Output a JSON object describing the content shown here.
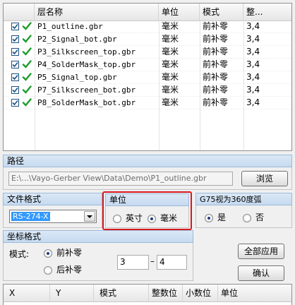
{
  "layer_table": {
    "columns": [
      "层名称",
      "单位",
      "模式",
      "整..."
    ],
    "rows": [
      {
        "name": "P1_outline.gbr",
        "unit": "毫米",
        "mode": "前补零",
        "int": "3,4",
        "checked": true
      },
      {
        "name": "P2_Signal_bot.gbr",
        "unit": "毫米",
        "mode": "前补零",
        "int": "3,4",
        "checked": true
      },
      {
        "name": "P3_Silkscreen_top.gbr",
        "unit": "毫米",
        "mode": "前补零",
        "int": "3,4",
        "checked": true
      },
      {
        "name": "P4_SolderMask_top.gbr",
        "unit": "毫米",
        "mode": "前补零",
        "int": "3,4",
        "checked": true
      },
      {
        "name": "P5_Signal_top.gbr",
        "unit": "毫米",
        "mode": "前补零",
        "int": "3,4",
        "checked": true
      },
      {
        "name": "P7_Silkscreen_bot.gbr",
        "unit": "毫米",
        "mode": "前补零",
        "int": "3,4",
        "checked": true
      },
      {
        "name": "P8_SolderMask_bot.gbr",
        "unit": "毫米",
        "mode": "前补零",
        "int": "3,4",
        "checked": true
      }
    ]
  },
  "path": {
    "title": "路径",
    "value": "E:\\...\\Vayo-Gerber View\\Data\\Demo\\P1_outline.gbr",
    "browse_label": "浏览"
  },
  "file_format": {
    "title": "文件格式",
    "selected": "RS-274-X"
  },
  "unit": {
    "title": "单位",
    "inch_label": "英寸",
    "mm_label": "毫米",
    "selected": "mm",
    "highlight_color": "#d9181e"
  },
  "g75": {
    "title": "G75视为360度弧",
    "yes_label": "是",
    "no_label": "否",
    "selected": "yes"
  },
  "coord_format": {
    "title": "坐标格式",
    "mode_label": "模式:",
    "leading_label": "前补零",
    "trailing_label": "后补零",
    "selected": "leading",
    "int_digits": "3",
    "dash": "–",
    "dec_digits": "4"
  },
  "actions": {
    "apply_all_label": "全部应用",
    "confirm_label": "确认"
  },
  "bottom_table": {
    "columns": [
      "X",
      "Y",
      "模式",
      "整数位",
      "小数位",
      "单位"
    ]
  },
  "colors": {
    "check_green": "#1c9c2a",
    "selection_blue": "#3399ff",
    "panel_title_bg": "#c6daf0"
  }
}
